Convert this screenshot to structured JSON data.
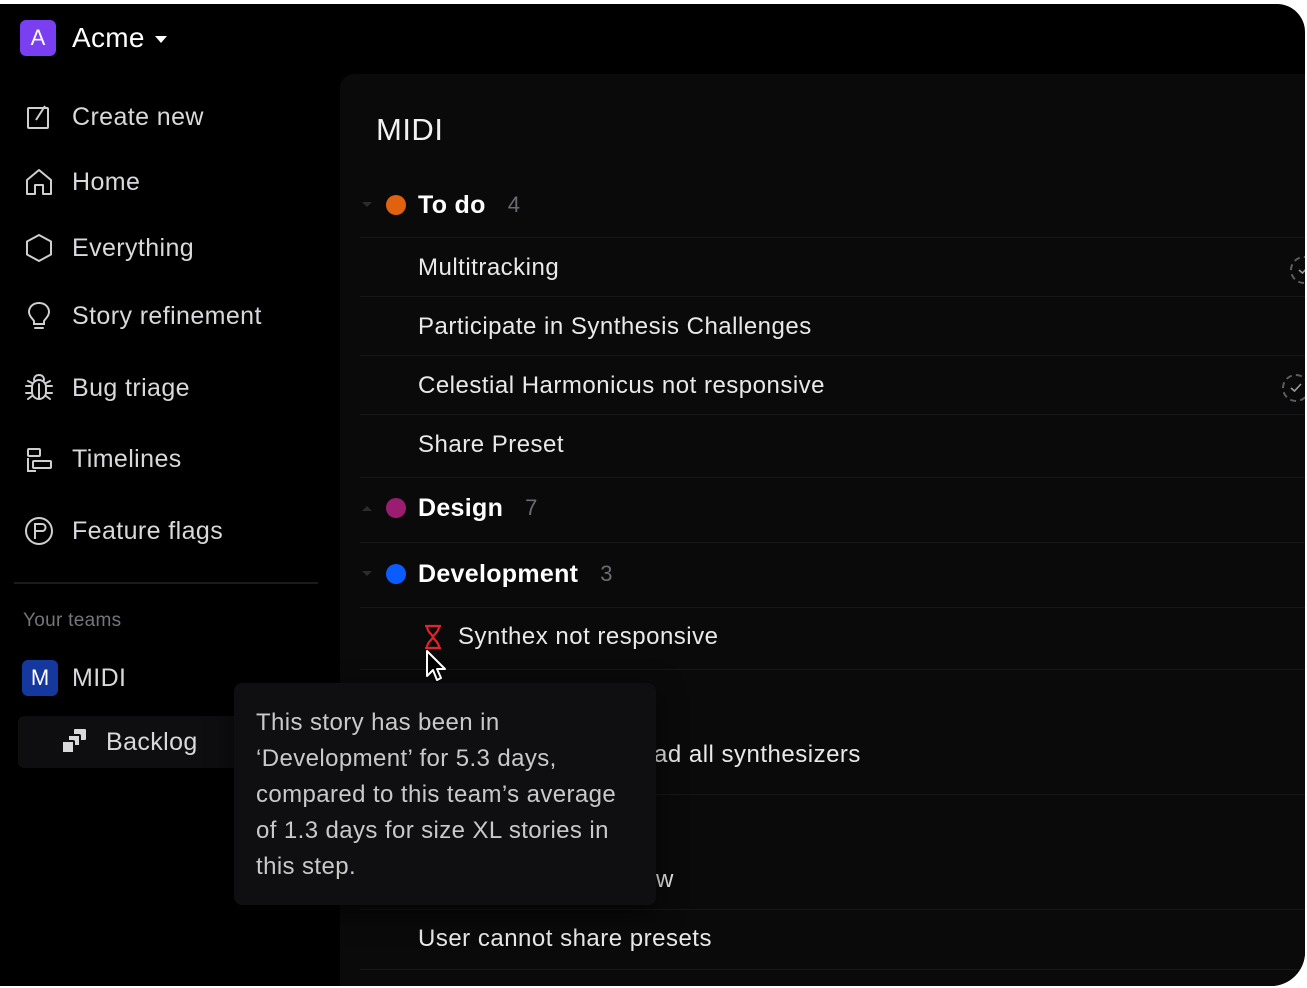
{
  "workspace": {
    "avatar_letter": "A",
    "name": "Acme"
  },
  "sidebar": {
    "items": [
      {
        "label": "Create new",
        "icon": "create-new-icon"
      },
      {
        "label": "Home",
        "icon": "home-icon"
      },
      {
        "label": "Everything",
        "icon": "hexagon-icon"
      },
      {
        "label": "Story refinement",
        "icon": "lightbulb-icon"
      },
      {
        "label": "Bug triage",
        "icon": "bug-icon"
      },
      {
        "label": "Timelines",
        "icon": "timeline-icon"
      },
      {
        "label": "Feature flags",
        "icon": "flag-circle-icon"
      }
    ],
    "section_label": "Your teams",
    "team": {
      "avatar_letter": "M",
      "name": "MIDI"
    },
    "team_child": {
      "label": "Backlog",
      "icon": "backlog-stack-icon"
    }
  },
  "main": {
    "title": "MIDI",
    "groups": [
      {
        "name": "To do",
        "count": "4",
        "color": "#e0610e",
        "expanded": true,
        "stories": [
          "Multitracking",
          "Participate in Synthesis Challenges",
          "Celestial Harmonicus not responsive",
          "Share Preset"
        ]
      },
      {
        "name": "Design",
        "count": "7",
        "color": "#9b1d72",
        "expanded": false,
        "stories": []
      },
      {
        "name": "Development",
        "count": "3",
        "color": "#0a5cff",
        "expanded": true,
        "stories": [
          "Synthex not responsive",
          "ad all synthesizers",
          "w",
          "User cannot share presets"
        ]
      }
    ]
  },
  "tooltip": {
    "text": "This story has been in ‘Development’ for 5.3 days, compared to this team’s average of 1.3 days for size XL stories in this step."
  },
  "colors": {
    "accent": "#7b3ff2",
    "team": "#14389d",
    "warning": "#e0242b"
  }
}
